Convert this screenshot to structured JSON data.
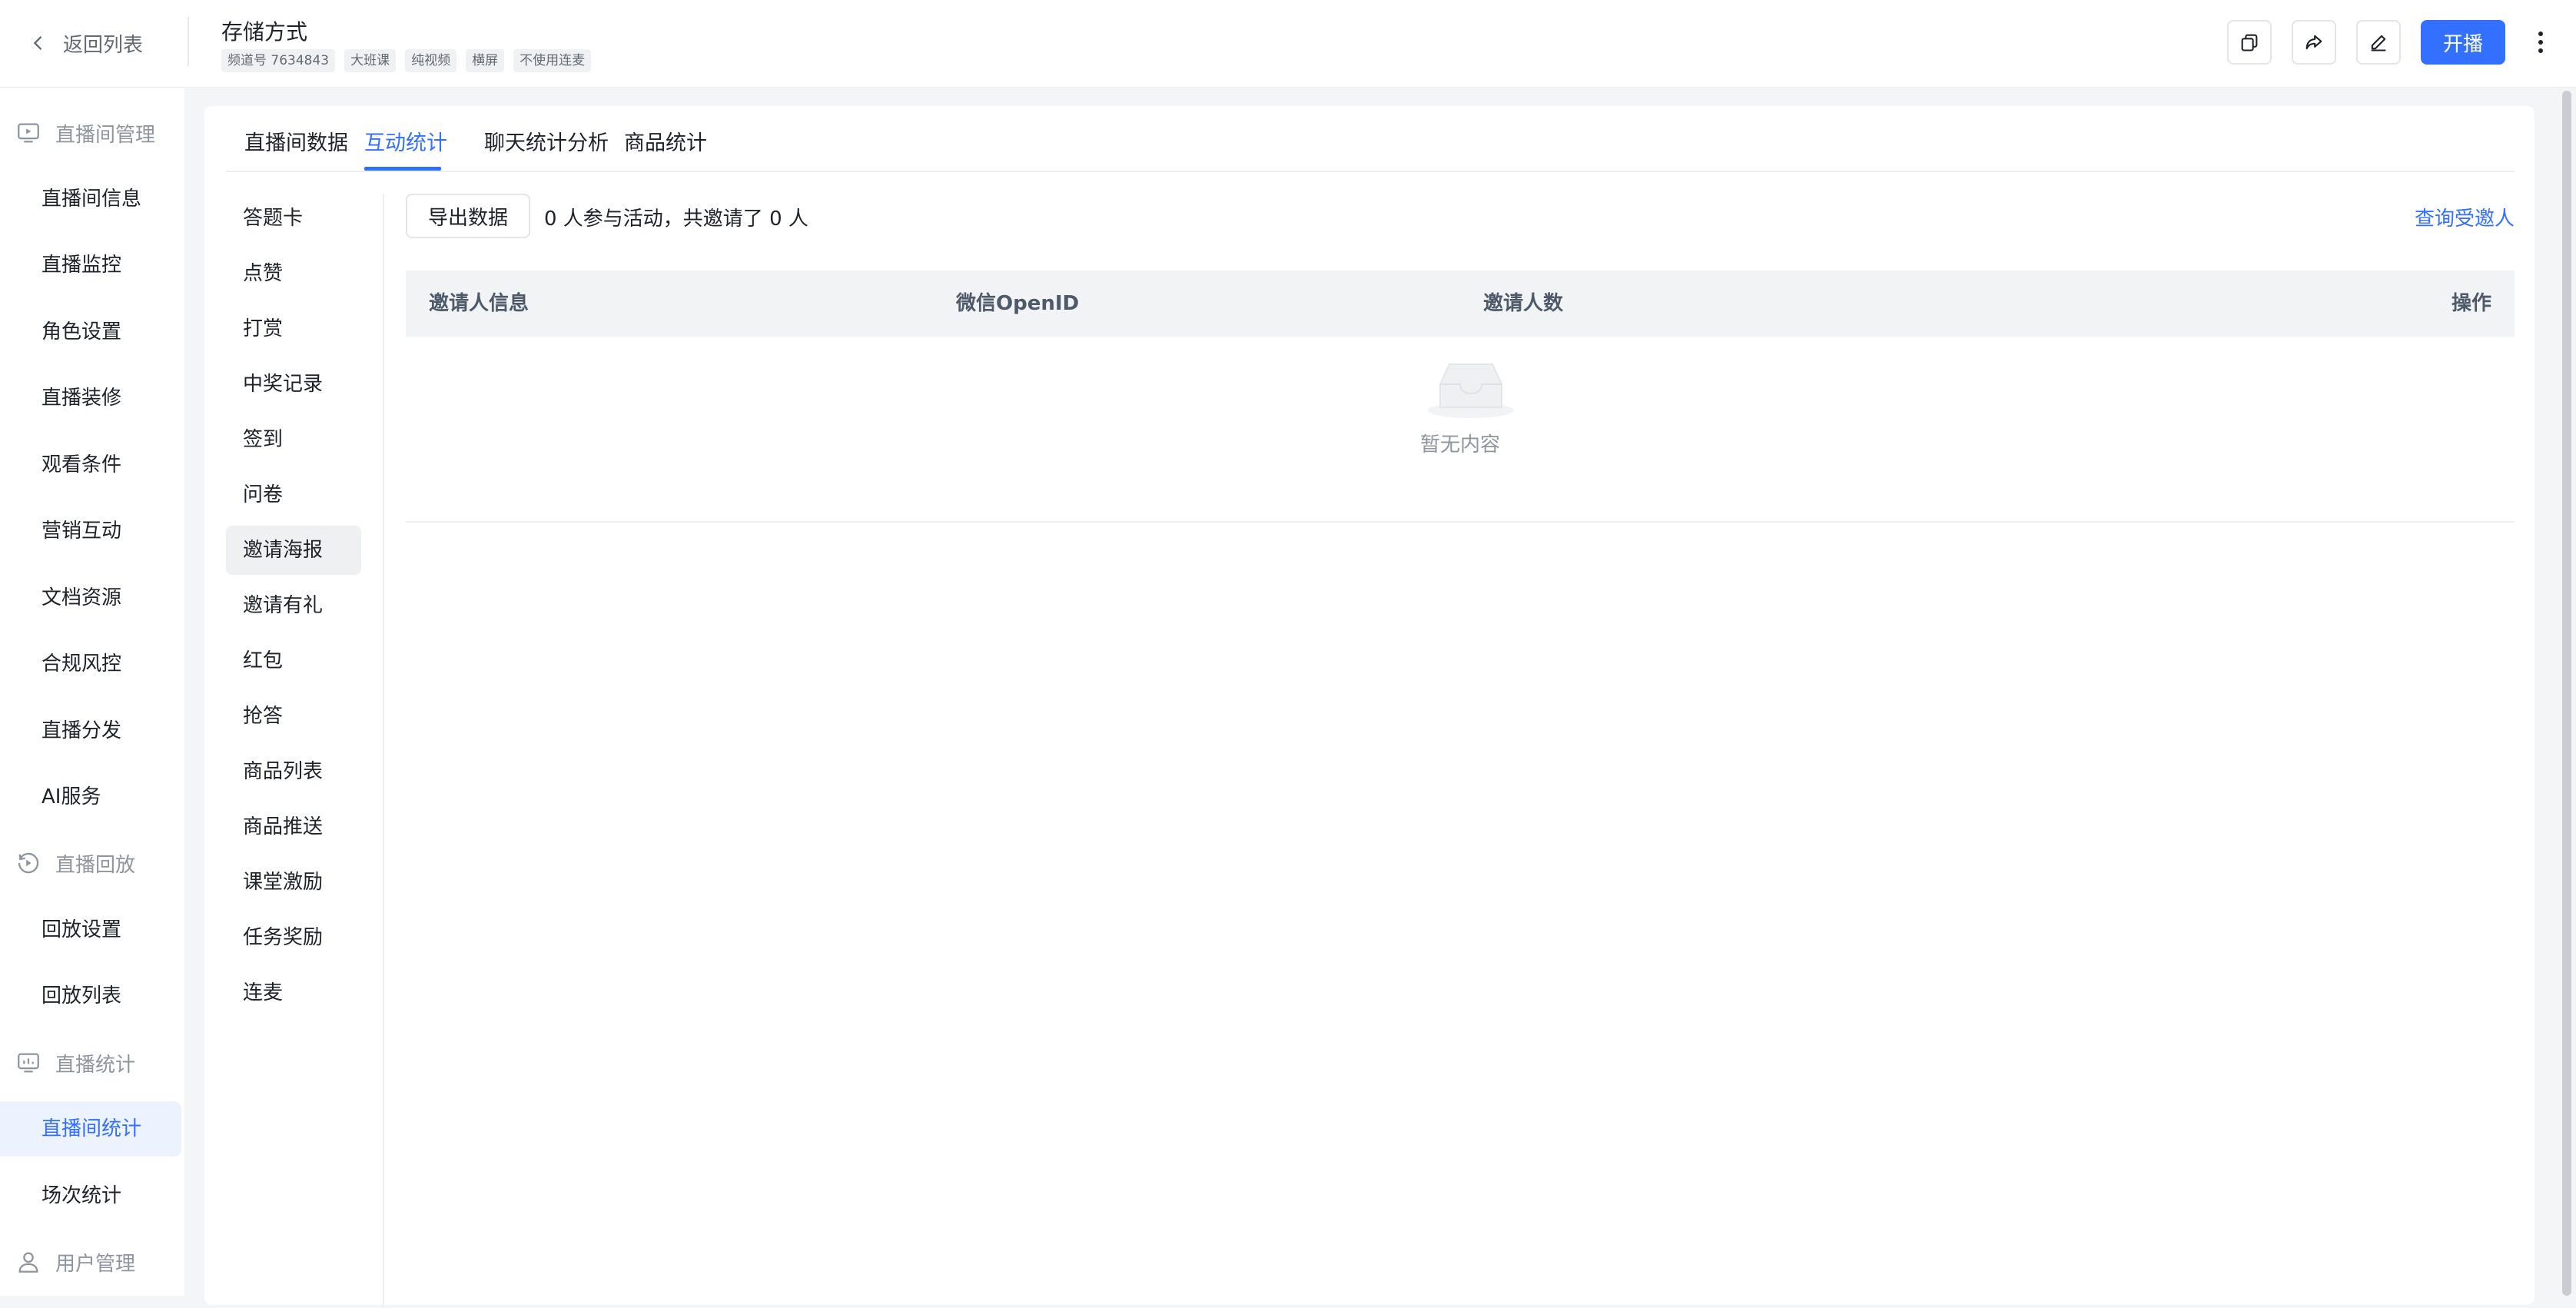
{
  "header": {
    "back_label": "返回列表",
    "title": "存储方式",
    "tags": [
      "频道号 7634843",
      "大班课",
      "纯视频",
      "横屏",
      "不使用连麦"
    ],
    "actions": {
      "copy_icon": "copy-icon",
      "share_icon": "share-icon",
      "edit_icon": "edit-icon",
      "primary_label": "开播",
      "more_icon": "more-vertical-icon"
    }
  },
  "sidebar": {
    "groups": [
      {
        "label": "直播间管理",
        "icon": "live-room-icon"
      },
      {
        "label": "直播回放",
        "icon": "replay-icon"
      },
      {
        "label": "直播统计",
        "icon": "statistics-icon"
      },
      {
        "label": "用户管理",
        "icon": "user-icon"
      }
    ],
    "items": [
      {
        "label": "直播间信息"
      },
      {
        "label": "直播监控"
      },
      {
        "label": "角色设置"
      },
      {
        "label": "直播装修"
      },
      {
        "label": "观看条件"
      },
      {
        "label": "营销互动"
      },
      {
        "label": "文档资源"
      },
      {
        "label": "合规风控"
      },
      {
        "label": "直播分发"
      },
      {
        "label": "AI服务"
      },
      {
        "label": "回放设置"
      },
      {
        "label": "回放列表"
      },
      {
        "label": "直播间统计"
      },
      {
        "label": "场次统计"
      }
    ],
    "active_item": "直播间统计"
  },
  "tabs": [
    {
      "label": "直播间数据"
    },
    {
      "label": "互动统计"
    },
    {
      "label": "聊天统计分析"
    },
    {
      "label": "商品统计"
    }
  ],
  "active_tab": "互动统计",
  "subnav": [
    {
      "label": "答题卡"
    },
    {
      "label": "点赞"
    },
    {
      "label": "打赏"
    },
    {
      "label": "中奖记录"
    },
    {
      "label": "签到"
    },
    {
      "label": "问卷"
    },
    {
      "label": "邀请海报"
    },
    {
      "label": "邀请有礼"
    },
    {
      "label": "红包"
    },
    {
      "label": "抢答"
    },
    {
      "label": "商品列表"
    },
    {
      "label": "商品推送"
    },
    {
      "label": "课堂激励"
    },
    {
      "label": "任务奖励"
    },
    {
      "label": "连麦"
    }
  ],
  "active_subnav": "邀请海报",
  "main": {
    "export_label": "导出数据",
    "summary": "0 人参与活动，共邀请了 0 人",
    "query_link": "查询受邀人",
    "columns": [
      "邀请人信息",
      "微信OpenID",
      "邀请人数",
      "操作"
    ],
    "empty_text": "暂无内容"
  },
  "colors": {
    "accent": "#3370ff",
    "active_bg": "#edf2ff",
    "muted_text": "#8f959e"
  }
}
